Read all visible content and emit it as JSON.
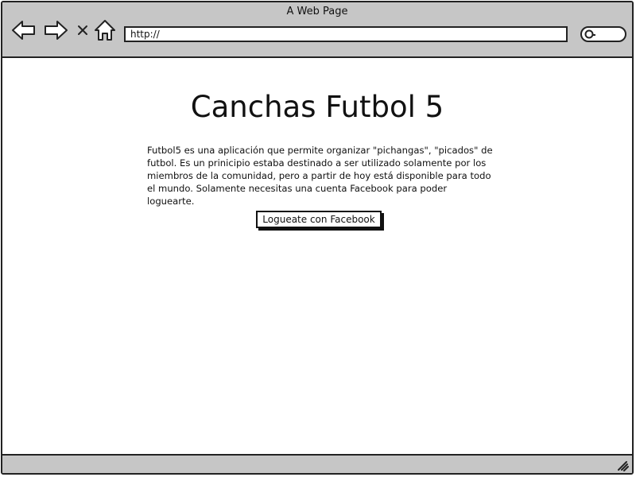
{
  "window": {
    "title": "A Web Page"
  },
  "toolbar": {
    "icons": [
      "back-arrow-icon",
      "forward-arrow-icon",
      "close-x-icon",
      "home-icon",
      "search-icon",
      "resize-grip-icon"
    ],
    "url_value": "http://"
  },
  "main": {
    "title": "Canchas Futbol 5",
    "description": "Futbol5 es una aplicación que permite organizar \"pichangas\", \"picados\" de futbol. Es un prinicipio estaba destinado a ser utilizado solamente por los miembros de la comunidad, pero a partir de hoy está disponible para todo el mundo. Solamente necesitas una cuenta Facebook para poder loguearte.",
    "login_button_label": "Logueate con Facebook"
  },
  "colors": {
    "chrome": "#c6c6c6",
    "outline": "#222222",
    "background": "#ffffff"
  }
}
